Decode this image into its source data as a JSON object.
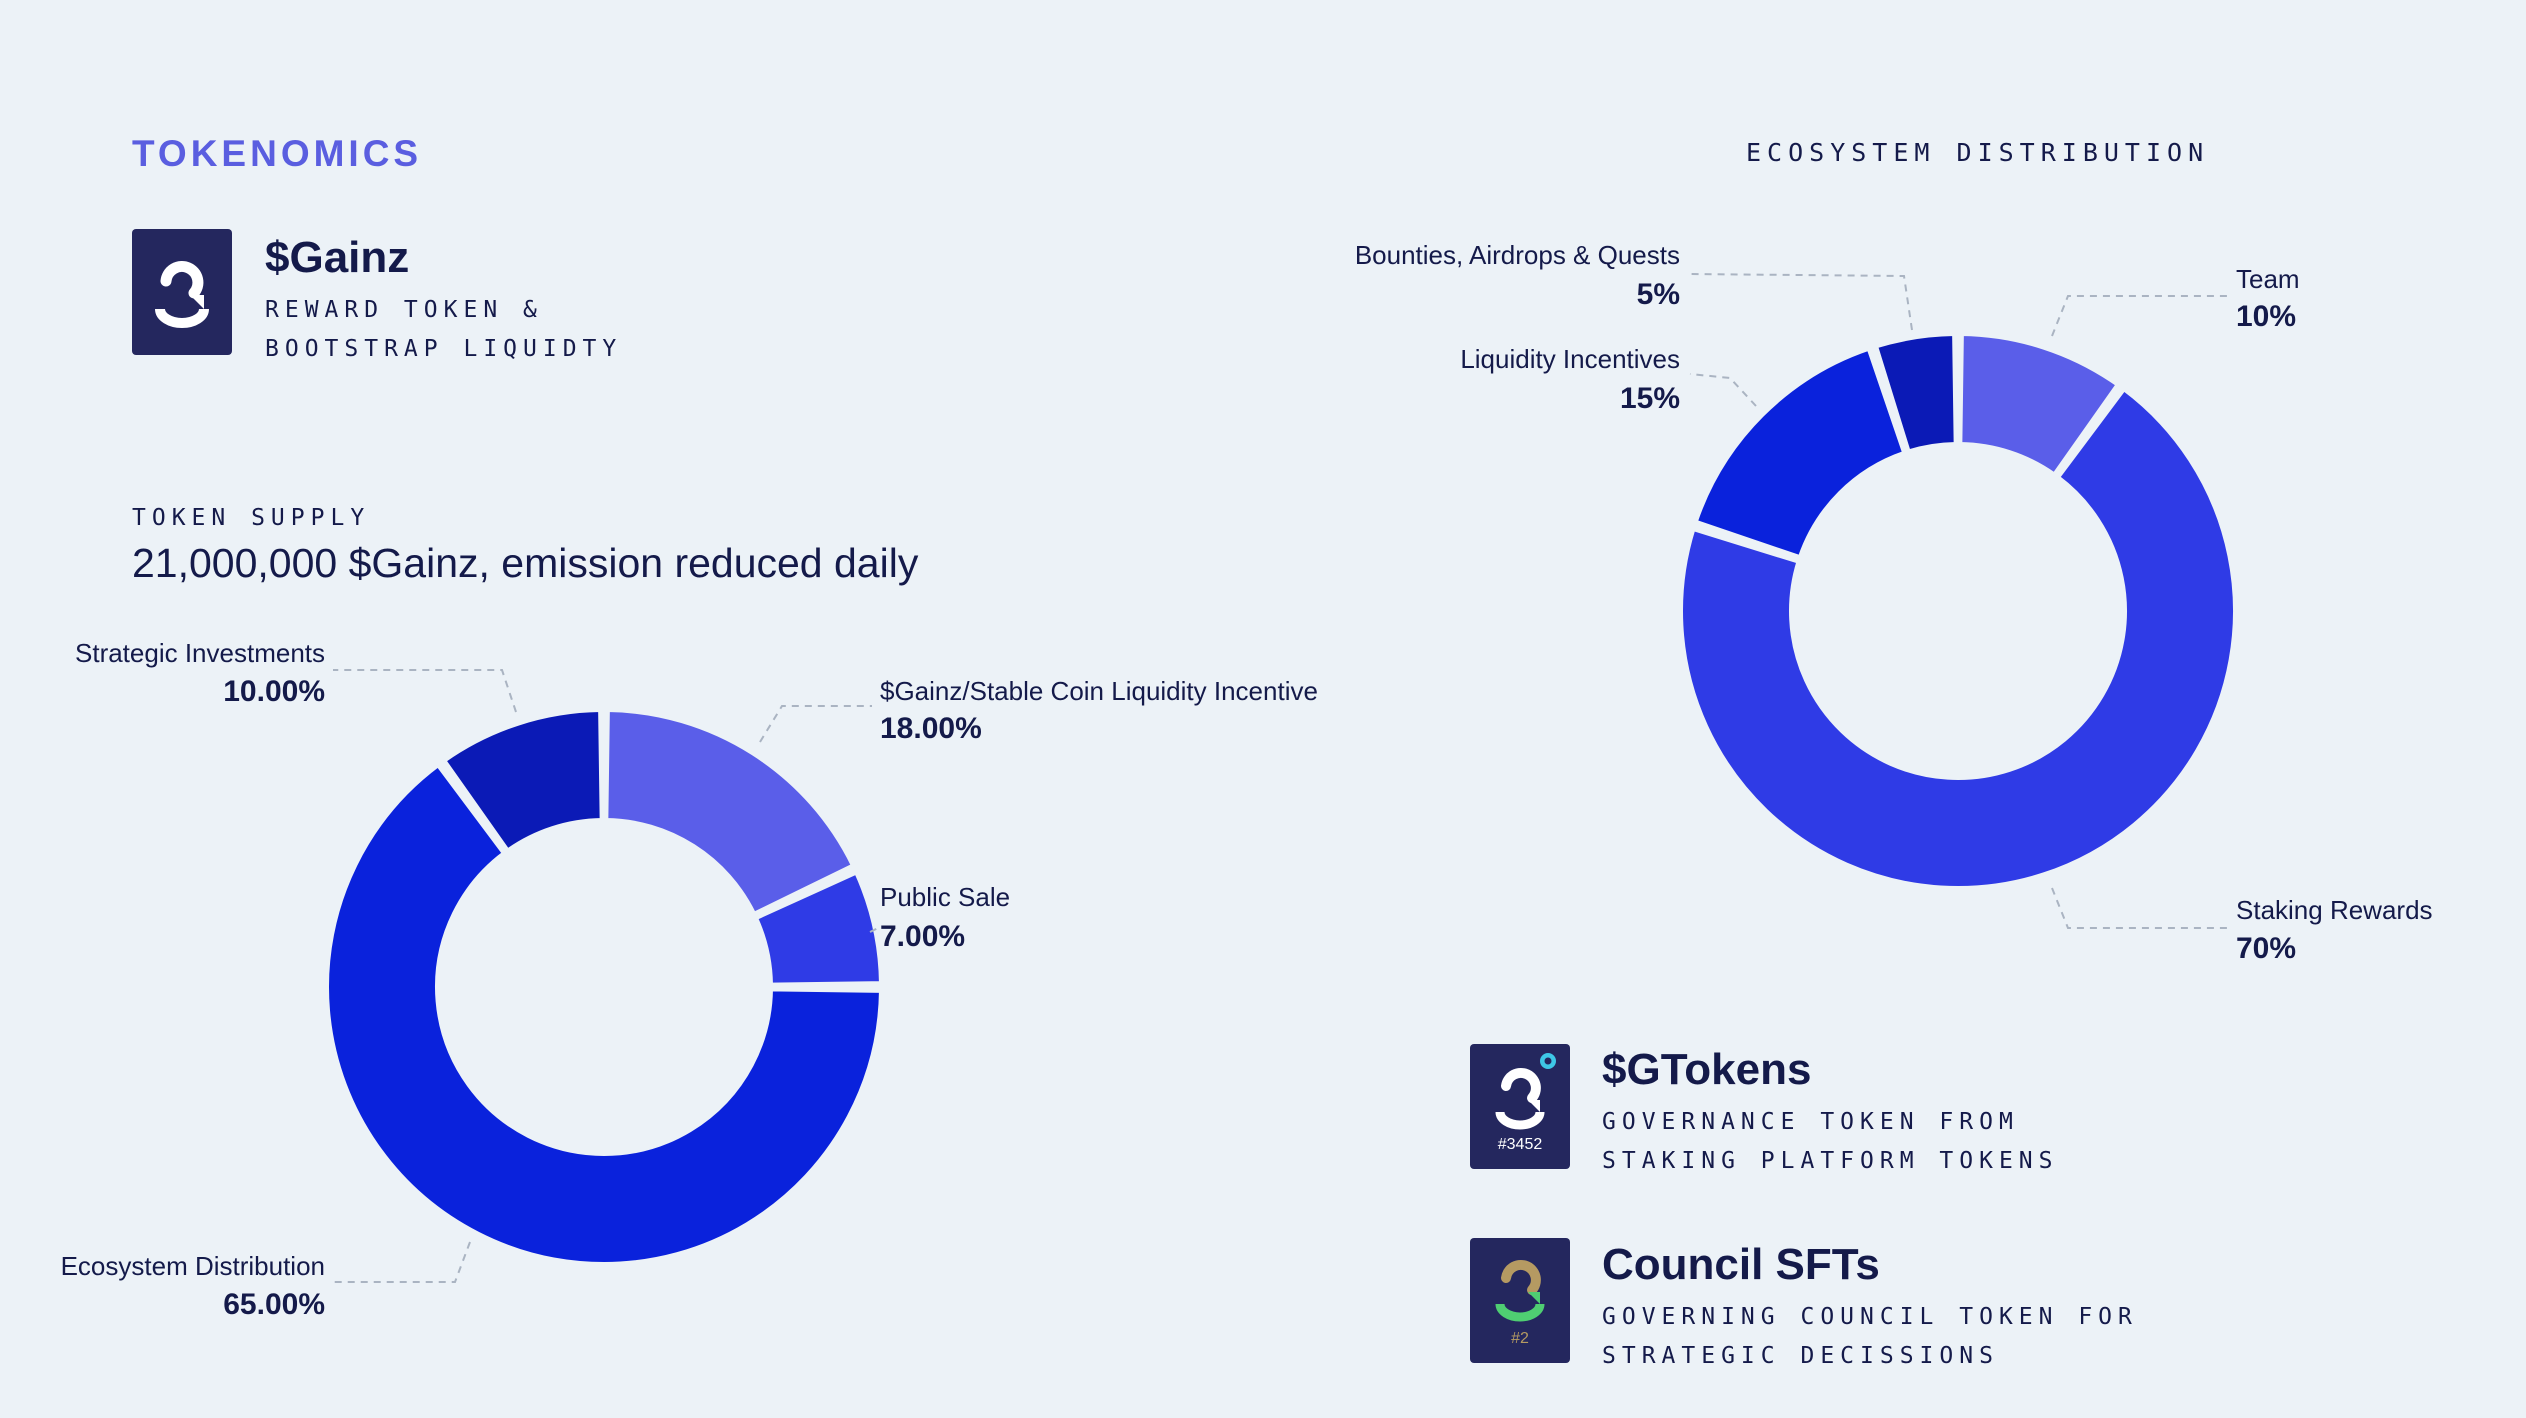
{
  "section_title": "TOKENOMICS",
  "gainz": {
    "name": "$Gainz",
    "sub_line1": "REWARD TOKEN &",
    "sub_line2": "BOOTSTRAP LIQUIDTY"
  },
  "supply": {
    "label": "TOKEN SUPPLY",
    "text": "21,000,000 $Gainz, emission reduced daily"
  },
  "ecosystem_title": "ECOSYSTEM DISTRIBUTION",
  "gtokens": {
    "name": "$GTokens",
    "sub_line1": "GOVERNANCE TOKEN FROM",
    "sub_line2": "STAKING PLATFORM TOKENS",
    "badge": "#3452"
  },
  "council": {
    "name": "Council SFTs",
    "sub_line1": "GOVERNING COUNCIL TOKEN FOR",
    "sub_line2": "STRATEGIC DECISSIONS",
    "badge": "#2"
  },
  "chart_data": [
    {
      "type": "pie",
      "donut": true,
      "slices": [
        {
          "label": "$Gainz/Stable Coin Liquidity Incentive",
          "value": 18.0,
          "display": "18.00%",
          "color": "#5a5ee9"
        },
        {
          "label": "Public Sale",
          "value": 7.0,
          "display": "7.00%",
          "color": "#2f3be6"
        },
        {
          "label": "Ecosystem Distribution",
          "value": 65.0,
          "display": "65.00%",
          "color": "#0a22dc"
        },
        {
          "label": "Strategic Investments",
          "value": 10.0,
          "display": "10.00%",
          "color": "#0b1ab6"
        }
      ]
    },
    {
      "type": "pie",
      "donut": true,
      "slices": [
        {
          "label": "Team",
          "value": 10,
          "display": "10%",
          "color": "#5a5ee9"
        },
        {
          "label": "Staking Rewards",
          "value": 70,
          "display": "70%",
          "color": "#2f3be6"
        },
        {
          "label": "Liquidity Incentives",
          "value": 15,
          "display": "15%",
          "color": "#0a22dc"
        },
        {
          "label": "Bounties, Airdrops & Quests",
          "value": 5,
          "display": "5%",
          "color": "#0b1ab6"
        }
      ]
    }
  ]
}
